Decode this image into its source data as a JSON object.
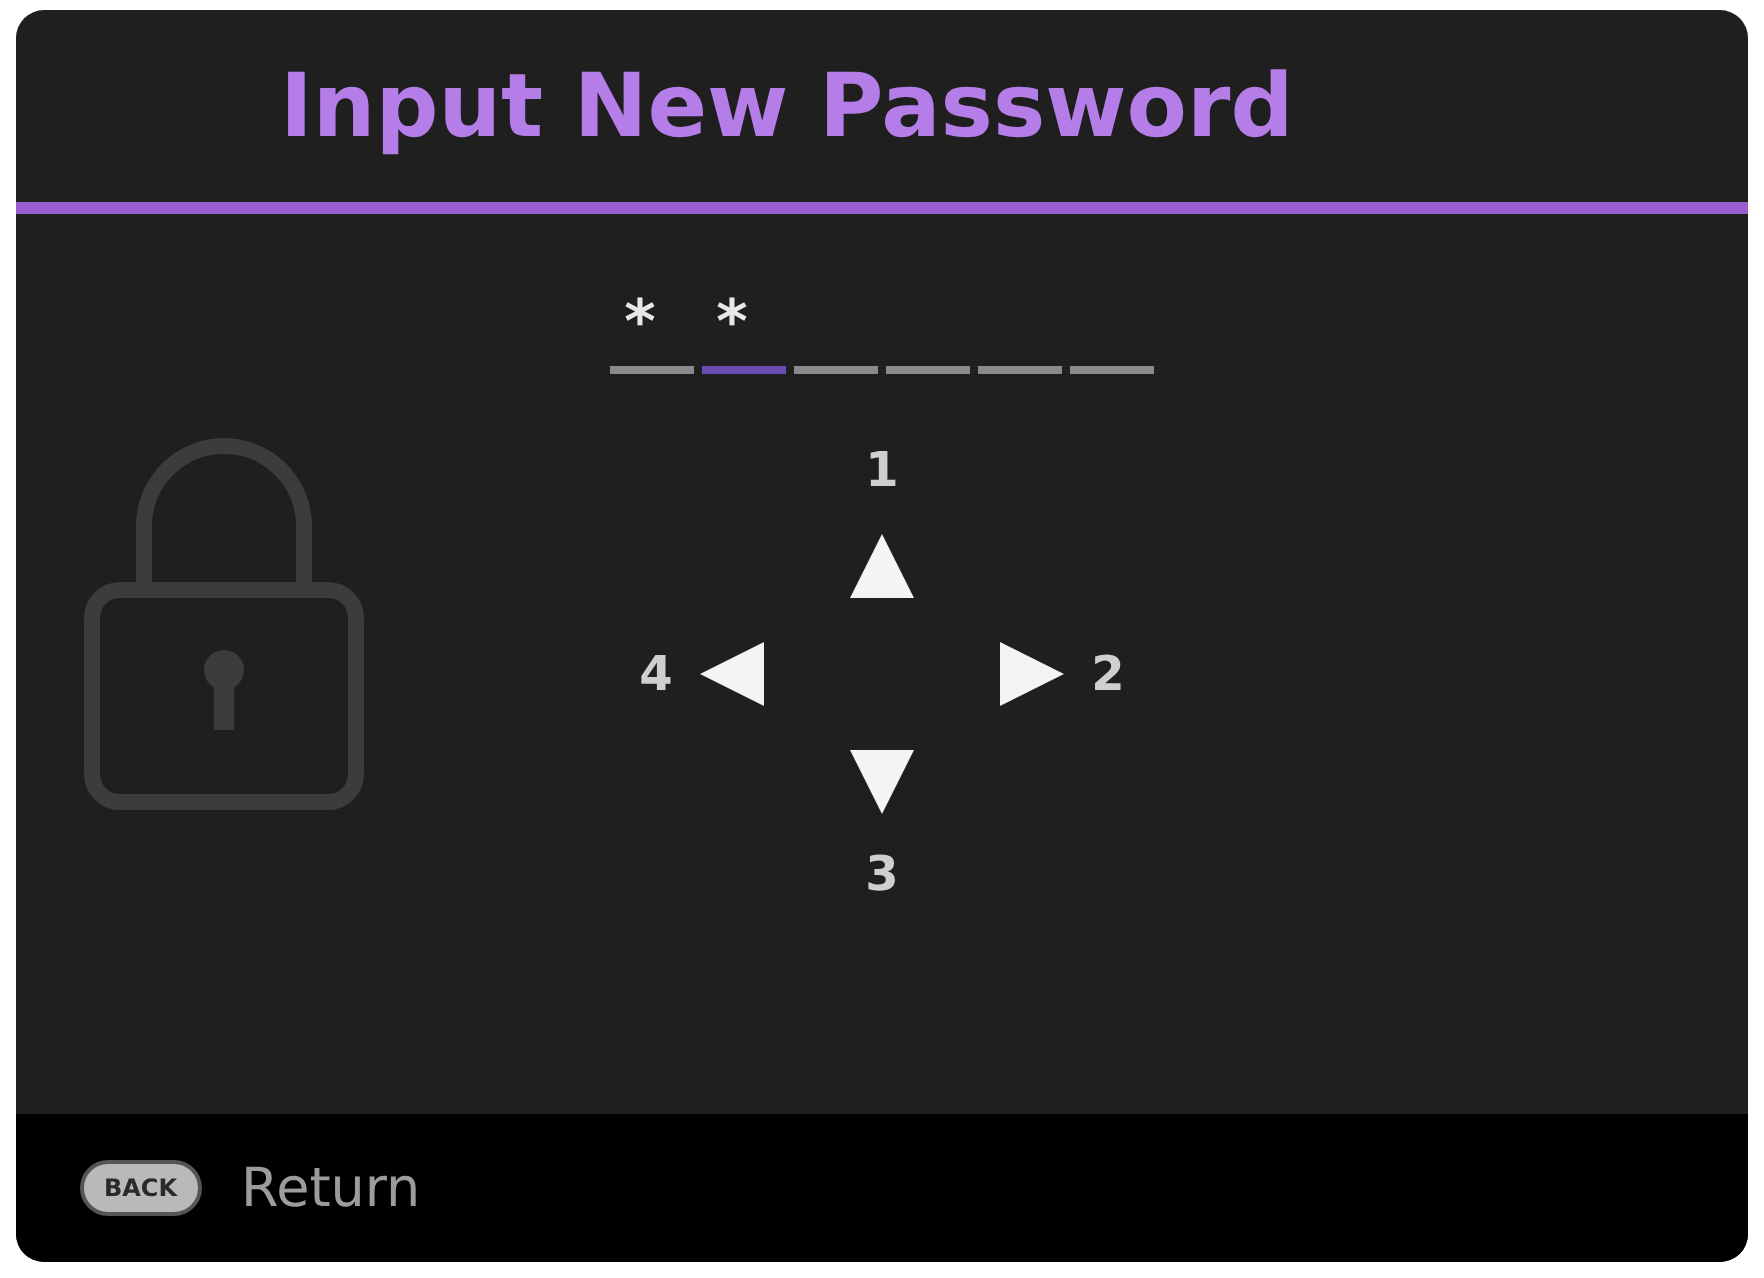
{
  "title": "Input New Password",
  "password_slots": [
    {
      "char": "*",
      "selected": false
    },
    {
      "char": "*",
      "selected": true
    },
    {
      "selected": false
    },
    {
      "selected": false
    },
    {
      "selected": false
    },
    {
      "selected": false
    }
  ],
  "direction_keys": [
    {
      "kind": "up",
      "label": "1"
    },
    {
      "kind": "right",
      "label": "2"
    },
    {
      "kind": "down",
      "label": "3"
    },
    {
      "kind": "left",
      "label": "4"
    }
  ],
  "footer": {
    "key": "BACK",
    "label": "Return"
  }
}
